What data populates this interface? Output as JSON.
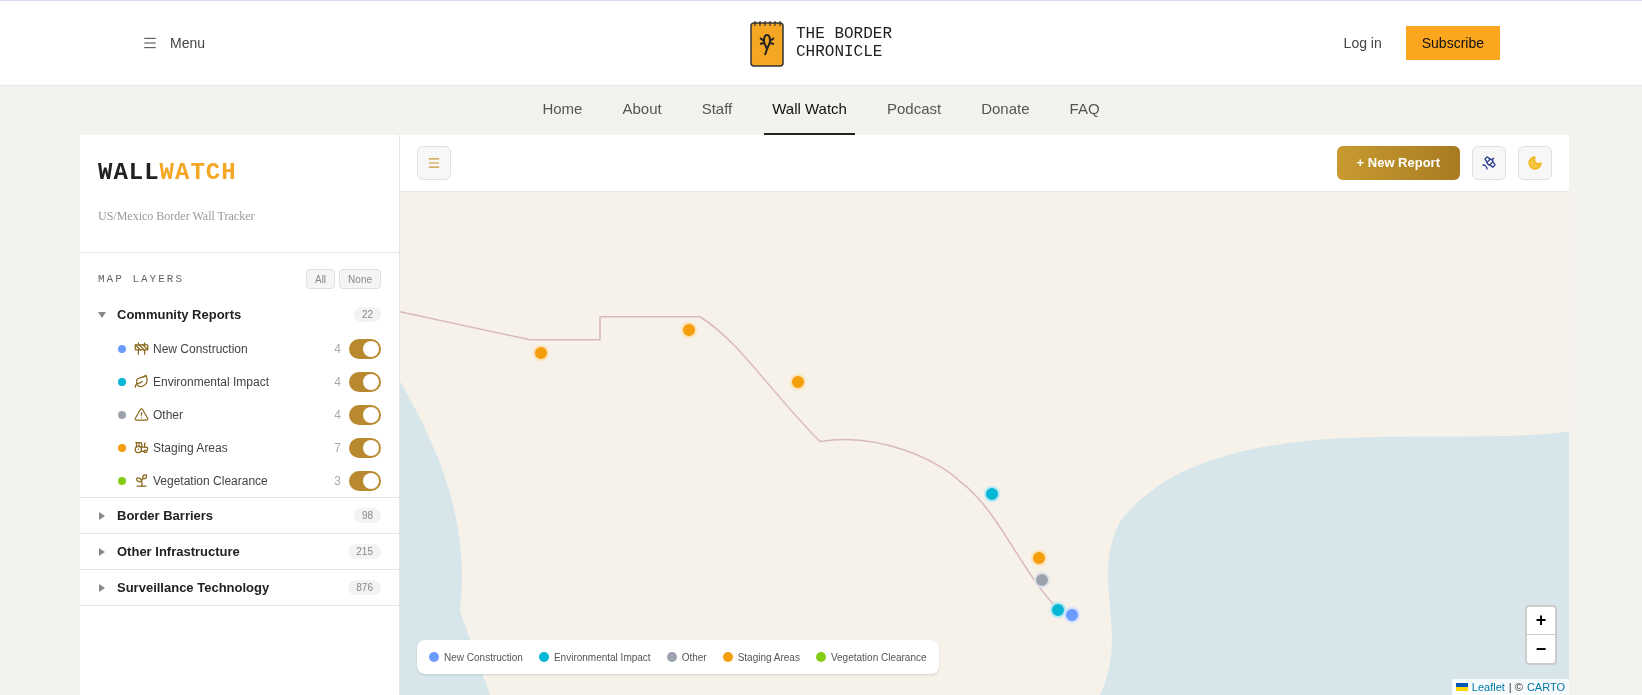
{
  "header": {
    "menu_label": "Menu",
    "logo_lines": [
      "THE BORDER",
      "CHRONICLE"
    ],
    "login": "Log in",
    "subscribe": "Subscribe"
  },
  "nav": [
    {
      "label": "Home",
      "selected": false
    },
    {
      "label": "About",
      "selected": false
    },
    {
      "label": "Staff",
      "selected": false
    },
    {
      "label": "Wall Watch",
      "selected": true
    },
    {
      "label": "Podcast",
      "selected": false
    },
    {
      "label": "Donate",
      "selected": false
    },
    {
      "label": "FAQ",
      "selected": false
    }
  ],
  "sidebar": {
    "title_dark": "WALL",
    "title_accent": "WATCH",
    "subtitle": "US/Mexico Border Wall Tracker",
    "layers_heading": "MAP LAYERS",
    "buttons": [
      "All",
      "None"
    ],
    "groups": [
      {
        "name": "Community Reports",
        "count": "22",
        "expanded": true,
        "children": [
          {
            "kind": "construction",
            "label": "New Construction",
            "color": "#6b9bff",
            "count": "4",
            "on": true
          },
          {
            "kind": "environment",
            "label": "Environmental Impact",
            "color": "#06b6d4",
            "count": "4",
            "on": true
          },
          {
            "kind": "other",
            "label": "Other",
            "color": "#9ca3af",
            "count": "4",
            "on": true
          },
          {
            "kind": "staging",
            "label": "Staging Areas",
            "color": "#f59e0b",
            "count": "7",
            "on": true
          },
          {
            "kind": "vegetation",
            "label": "Vegetation Clearance",
            "color": "#84cc16",
            "count": "3",
            "on": true
          }
        ]
      },
      {
        "name": "Border Barriers",
        "count": "98",
        "expanded": false
      },
      {
        "name": "Other Infrastructure",
        "count": "215",
        "expanded": false
      },
      {
        "name": "Surveillance Technology",
        "count": "876",
        "expanded": false
      }
    ]
  },
  "toolbar": {
    "new_report": "+ New Report"
  },
  "map": {
    "legend": [
      {
        "label": "New Construction",
        "color": "#6b9bff"
      },
      {
        "label": "Environmental Impact",
        "color": "#06b6d4"
      },
      {
        "label": "Other",
        "color": "#9ca3af"
      },
      {
        "label": "Staging Areas",
        "color": "#f59e0b"
      },
      {
        "label": "Vegetation Clearance",
        "color": "#84cc16"
      }
    ],
    "zoom_in": "+",
    "zoom_out": "−",
    "attribution": {
      "leaflet": "Leaflet",
      "separator": "| ©",
      "carto": "CARTO"
    }
  }
}
